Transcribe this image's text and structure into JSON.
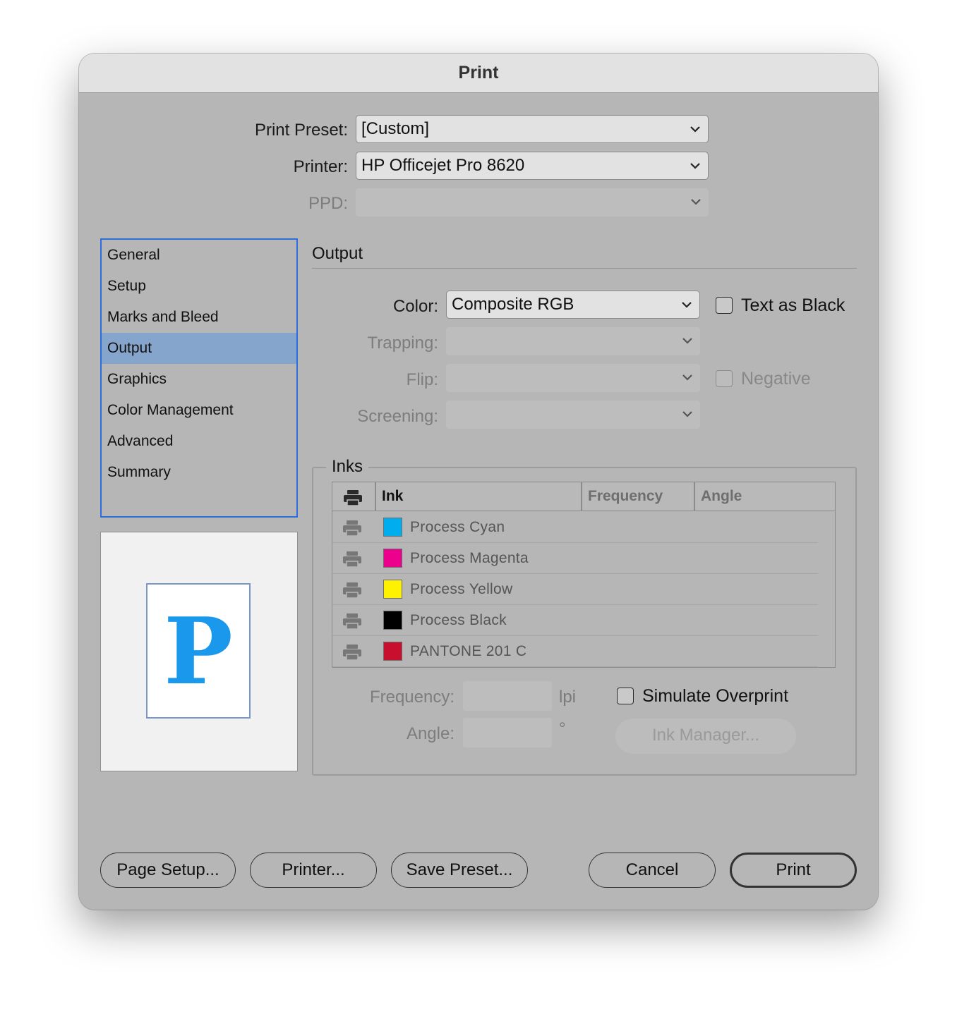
{
  "window": {
    "title": "Print"
  },
  "top_fields": {
    "print_preset": {
      "label": "Print Preset:",
      "value": "[Custom]"
    },
    "printer": {
      "label": "Printer:",
      "value": "HP Officejet Pro 8620"
    },
    "ppd": {
      "label": "PPD:",
      "value": ""
    }
  },
  "sidebar": {
    "items": [
      {
        "label": "General"
      },
      {
        "label": "Setup"
      },
      {
        "label": "Marks and Bleed"
      },
      {
        "label": "Output",
        "selected": true
      },
      {
        "label": "Graphics"
      },
      {
        "label": "Color Management"
      },
      {
        "label": "Advanced"
      },
      {
        "label": "Summary"
      }
    ]
  },
  "preview": {
    "letter": "P"
  },
  "output": {
    "section_title": "Output",
    "color": {
      "label": "Color:",
      "value": "Composite RGB"
    },
    "trapping": {
      "label": "Trapping:",
      "value": ""
    },
    "flip": {
      "label": "Flip:",
      "value": ""
    },
    "screening": {
      "label": "Screening:",
      "value": ""
    },
    "text_as_black": {
      "label": "Text as Black",
      "checked": false
    },
    "negative": {
      "label": "Negative",
      "checked": false
    }
  },
  "inks": {
    "group_title": "Inks",
    "columns": {
      "ink": "Ink",
      "frequency": "Frequency",
      "angle": "Angle"
    },
    "rows": [
      {
        "name": "Process Cyan",
        "color": "#00aef0"
      },
      {
        "name": "Process Magenta",
        "color": "#ec008c"
      },
      {
        "name": "Process Yellow",
        "color": "#fff200"
      },
      {
        "name": "Process Black",
        "color": "#000000"
      },
      {
        "name": "PANTONE 201 C",
        "color": "#c8102e"
      }
    ],
    "frequency": {
      "label": "Frequency:",
      "unit": "lpi"
    },
    "angle": {
      "label": "Angle:",
      "unit": "°"
    },
    "simulate_overprint": {
      "label": "Simulate Overprint",
      "checked": false
    },
    "ink_manager_label": "Ink Manager..."
  },
  "buttons": {
    "page_setup": "Page Setup...",
    "printer": "Printer...",
    "save_preset": "Save Preset...",
    "cancel": "Cancel",
    "print": "Print"
  }
}
